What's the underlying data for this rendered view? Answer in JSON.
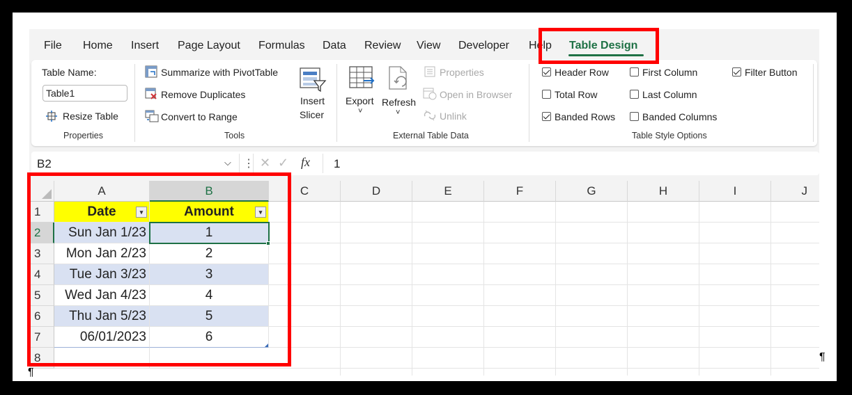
{
  "menu": {
    "tabs": [
      "File",
      "Home",
      "Insert",
      "Page Layout",
      "Formulas",
      "Data",
      "Review",
      "View",
      "Developer",
      "Help",
      "Table Design"
    ],
    "active": "Table Design"
  },
  "ribbon": {
    "properties": {
      "table_name_label": "Table Name:",
      "table_name_value": "Table1",
      "resize_label": "Resize Table",
      "group_label": "Properties"
    },
    "tools": {
      "summarize_label": "Summarize with PivotTable",
      "remove_dup_label": "Remove Duplicates",
      "convert_label": "Convert to Range",
      "insert_slicer_line1": "Insert",
      "insert_slicer_line2": "Slicer",
      "group_label": "Tools"
    },
    "external": {
      "export_label": "Export",
      "refresh_label": "Refresh",
      "properties_label": "Properties",
      "open_browser_label": "Open in Browser",
      "unlink_label": "Unlink",
      "group_label": "External Table Data"
    },
    "style_options": {
      "header_row": {
        "label": "Header Row",
        "checked": true
      },
      "total_row": {
        "label": "Total Row",
        "checked": false
      },
      "banded_rows": {
        "label": "Banded Rows",
        "checked": true
      },
      "first_column": {
        "label": "First Column",
        "checked": false
      },
      "last_column": {
        "label": "Last Column",
        "checked": false
      },
      "banded_columns": {
        "label": "Banded Columns",
        "checked": false
      },
      "filter_button": {
        "label": "Filter Button",
        "checked": true
      },
      "group_label": "Table Style Options"
    }
  },
  "formula_bar": {
    "name_box": "B2",
    "fx": "fx",
    "value": "1"
  },
  "sheet": {
    "columns": [
      "A",
      "B",
      "C",
      "D",
      "E",
      "F",
      "G",
      "H",
      "I",
      "J"
    ],
    "rows": [
      "1",
      "2",
      "3",
      "4",
      "5",
      "6",
      "7",
      "8"
    ],
    "table_headers": [
      "Date",
      "Amount"
    ],
    "table_rows": [
      {
        "date": "Sun Jan 1/23",
        "amount": "1"
      },
      {
        "date": "Mon Jan 2/23",
        "amount": "2"
      },
      {
        "date": "Tue Jan 3/23",
        "amount": "3"
      },
      {
        "date": "Wed Jan 4/23",
        "amount": "4"
      },
      {
        "date": "Thu Jan 5/23",
        "amount": "5"
      },
      {
        "date": "06/01/2023",
        "amount": "6"
      }
    ],
    "selected_cell": "B2"
  },
  "colors": {
    "header_fill": "#ffff00",
    "band_fill": "#d9e1f2",
    "accent_green": "#1e7145",
    "highlight_red": "#ff0000"
  },
  "pilcrow": "¶"
}
